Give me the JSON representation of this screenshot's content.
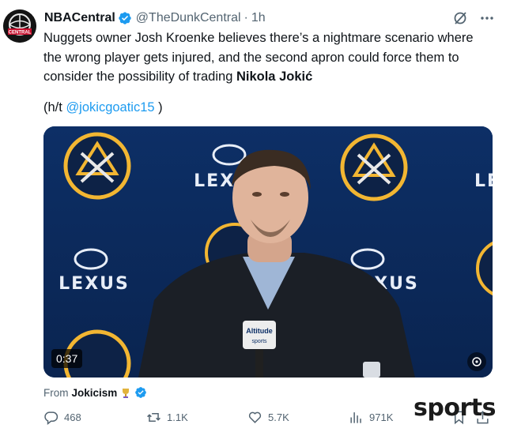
{
  "tweet": {
    "author": {
      "display_name": "NBACentral",
      "handle": "@TheDunkCentral",
      "verified": true
    },
    "separator": "·",
    "time": "1h",
    "text": {
      "body": "Nuggets owner Josh Kroenke believes there’s a nightmare scenario where the wrong player gets injured, and the second apron could force them to consider the possibility of trading ",
      "bold": "Nikola Jokić"
    },
    "ht": {
      "prefix": "(h/t ",
      "mention": "@jokicgoatic15",
      "suffix": " )"
    }
  },
  "media": {
    "type": "video",
    "timestamp": "0:37",
    "backdrop_text": "LEXUS",
    "microphone_label_top": "Altitude",
    "microphone_label_bottom": "sports"
  },
  "attribution": {
    "prefix": "From",
    "source": "Jokicism",
    "verified": true
  },
  "actions": {
    "replies": "468",
    "reposts": "1.1K",
    "likes": "5.7K",
    "views": "971K"
  },
  "watermark": "sports",
  "colors": {
    "link": "#1d9bf0",
    "muted": "#536471",
    "text": "#0f1419",
    "verified_badge": "#1d9bf0"
  }
}
